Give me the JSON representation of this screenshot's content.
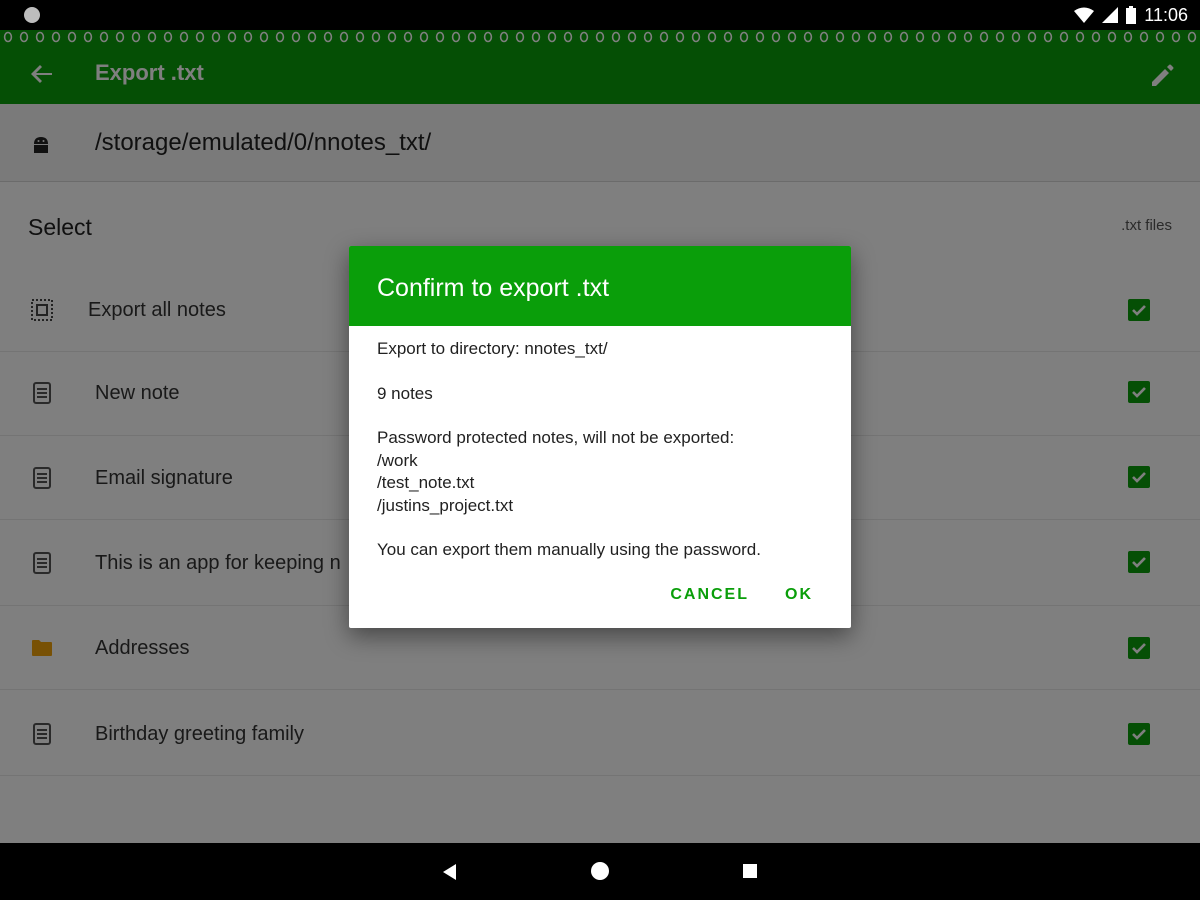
{
  "status_bar": {
    "time": "11:06"
  },
  "toolbar": {
    "title": "Export .txt"
  },
  "path": {
    "value": "/storage/emulated/0/nnotes_txt/"
  },
  "list": {
    "select_label": "Select",
    "files_label": ".txt files",
    "items": [
      {
        "label": "Export all notes",
        "icon": "select-all-icon",
        "checked": true
      },
      {
        "label": "New note",
        "icon": "note-icon",
        "checked": true
      },
      {
        "label": "Email signature",
        "icon": "note-icon",
        "checked": true
      },
      {
        "label": "This is an app for keeping n",
        "icon": "note-icon",
        "checked": true
      },
      {
        "label": "Addresses",
        "icon": "folder-icon",
        "checked": true
      },
      {
        "label": "Birthday greeting family",
        "icon": "note-icon",
        "checked": true
      }
    ]
  },
  "dialog": {
    "title": "Confirm to export .txt",
    "directory_line": "Export to directory: nnotes_txt/",
    "count_line": "9 notes",
    "protected_header": "Password protected notes, will not be exported:",
    "protected_items": [
      "/work",
      "/test_note.txt",
      "/justins_project.txt"
    ],
    "manual_line": "You can export them manually using the password.",
    "cancel_label": "CANCEL",
    "ok_label": "OK"
  },
  "colors": {
    "accent": "#0a9e0a",
    "folder": "#f0a30a"
  }
}
